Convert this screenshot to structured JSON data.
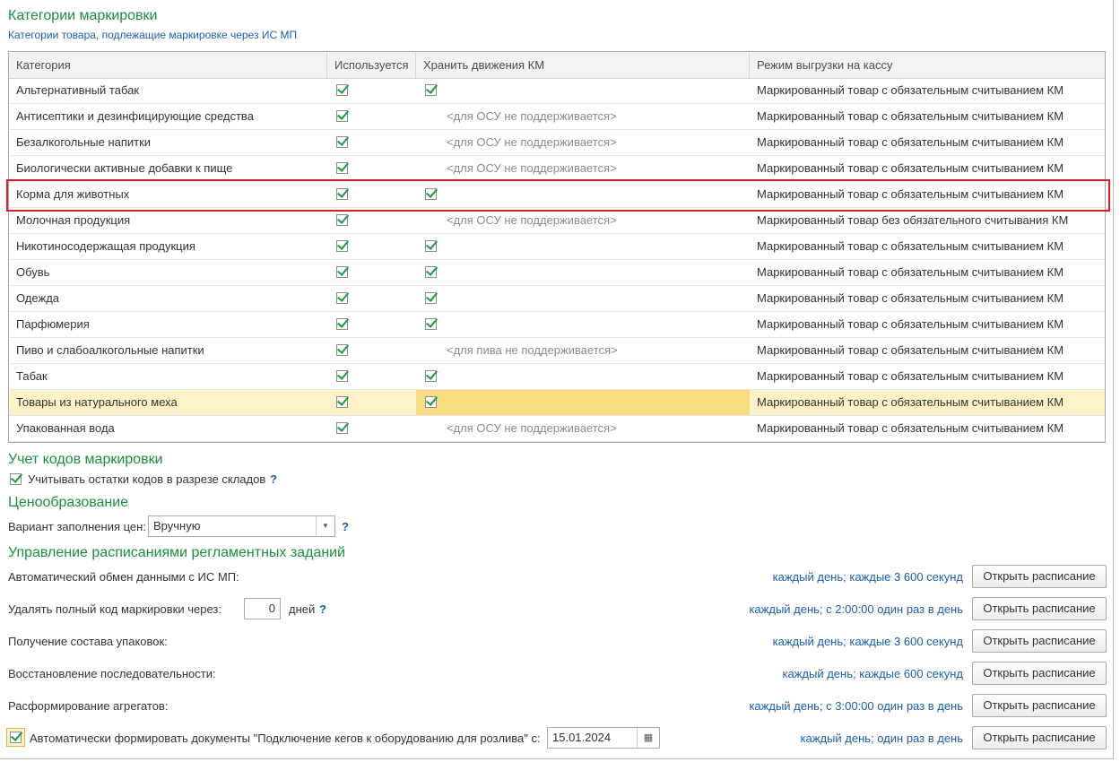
{
  "sections": {
    "categories_title": "Категории маркировки",
    "categories_subtitle": "Категории товара, подлежащие маркировке через ИС МП",
    "codes_title": "Учет кодов маркировки",
    "pricing_title": "Ценообразование",
    "schedules_title": "Управление расписаниями регламентных заданий"
  },
  "table": {
    "headers": [
      "Категория",
      "Используется",
      "Хранить движения КМ",
      "Режим выгрузки на кассу"
    ],
    "rows": [
      {
        "category": "Альтернативный табак",
        "used": true,
        "store_km": true,
        "store_note": "",
        "mode": "Маркированный товар с обязательным считыванием КМ"
      },
      {
        "category": "Антисептики и дезинфицирующие средства",
        "used": true,
        "store_km": false,
        "store_note": "<для ОСУ не поддерживается>",
        "mode": "Маркированный товар с обязательным считыванием КМ"
      },
      {
        "category": "Безалкогольные напитки",
        "used": true,
        "store_km": false,
        "store_note": "<для ОСУ не поддерживается>",
        "mode": "Маркированный товар с обязательным считыванием КМ"
      },
      {
        "category": "Биологически активные добавки к пище",
        "used": true,
        "store_km": false,
        "store_note": "<для ОСУ не поддерживается>",
        "mode": "Маркированный товар с обязательным считыванием КМ"
      },
      {
        "category": "Корма для животных",
        "used": true,
        "store_km": true,
        "store_note": "",
        "mode": "Маркированный товар с обязательным считыванием КМ"
      },
      {
        "category": "Молочная продукция",
        "used": true,
        "store_km": false,
        "store_note": "<для ОСУ не поддерживается>",
        "mode": "Маркированный товар без обязательного считывания КМ"
      },
      {
        "category": "Никотиносодержащая продукция",
        "used": true,
        "store_km": true,
        "store_note": "",
        "mode": "Маркированный товар с обязательным считыванием КМ"
      },
      {
        "category": "Обувь",
        "used": true,
        "store_km": true,
        "store_note": "",
        "mode": "Маркированный товар с обязательным считыванием КМ"
      },
      {
        "category": "Одежда",
        "used": true,
        "store_km": true,
        "store_note": "",
        "mode": "Маркированный товар с обязательным считыванием КМ"
      },
      {
        "category": "Парфюмерия",
        "used": true,
        "store_km": true,
        "store_note": "",
        "mode": "Маркированный товар с обязательным считыванием КМ"
      },
      {
        "category": "Пиво и слабоалкогольные напитки",
        "used": true,
        "store_km": false,
        "store_note": "<для пива не поддерживается>",
        "mode": "Маркированный товар с обязательным считыванием КМ"
      },
      {
        "category": "Табак",
        "used": true,
        "store_km": true,
        "store_note": "",
        "mode": "Маркированный товар с обязательным считыванием КМ"
      },
      {
        "category": "Товары из натурального меха",
        "used": true,
        "store_km": true,
        "store_note": "",
        "mode": "Маркированный товар с обязательным считыванием КМ",
        "selected": true
      },
      {
        "category": "Упакованная вода",
        "used": true,
        "store_km": false,
        "store_note": "<для ОСУ не поддерживается>",
        "mode": "Маркированный товар с обязательным считыванием КМ"
      }
    ]
  },
  "codes": {
    "warehouse_label": "Учитывать остатки кодов в разрезе складов",
    "warehouse_checked": true,
    "help": "?"
  },
  "pricing": {
    "fill_label": "Вариант заполнения цен:",
    "fill_value": "Вручную",
    "help": "?"
  },
  "schedules": {
    "open_label": "Открыть расписание",
    "items": [
      {
        "label": "Автоматический обмен данными с ИС МП:",
        "schedule": "каждый день; каждые 3 600 секунд"
      },
      {
        "label": "Удалять полный код маркировки через:",
        "schedule": "каждый день; с 2:00:00 один раз в день"
      },
      {
        "label": "Получение состава упаковок:",
        "schedule": "каждый день; каждые 3 600 секунд"
      },
      {
        "label": "Восстановление последовательности:",
        "schedule": "каждый день; каждые 600 секунд"
      },
      {
        "label": "Расформирование агрегатов:",
        "schedule": "каждый день; с 3:00:00 один раз в день"
      },
      {
        "label": "Автоматически формировать документы \"Подключение кегов к оборудованию для розлива\" с:",
        "schedule": "каждый день; один раз в день"
      }
    ],
    "delete_days_value": "0",
    "delete_days_unit": "дней",
    "help": "?",
    "kegs_checked": true,
    "kegs_date": "15.01.2024"
  },
  "icons": {
    "dropdown": "chevron-down-icon",
    "calendar": "calendar-icon",
    "checkbox": "checkmark-icon"
  },
  "colors": {
    "heading_green": "#1a8f3c",
    "link_blue": "#1c5ea8",
    "selected_row": "#fdf2c7",
    "selected_cell": "#f7dc84",
    "highlight_frame": "#d6202a",
    "check_green": "#1a9a3e"
  }
}
